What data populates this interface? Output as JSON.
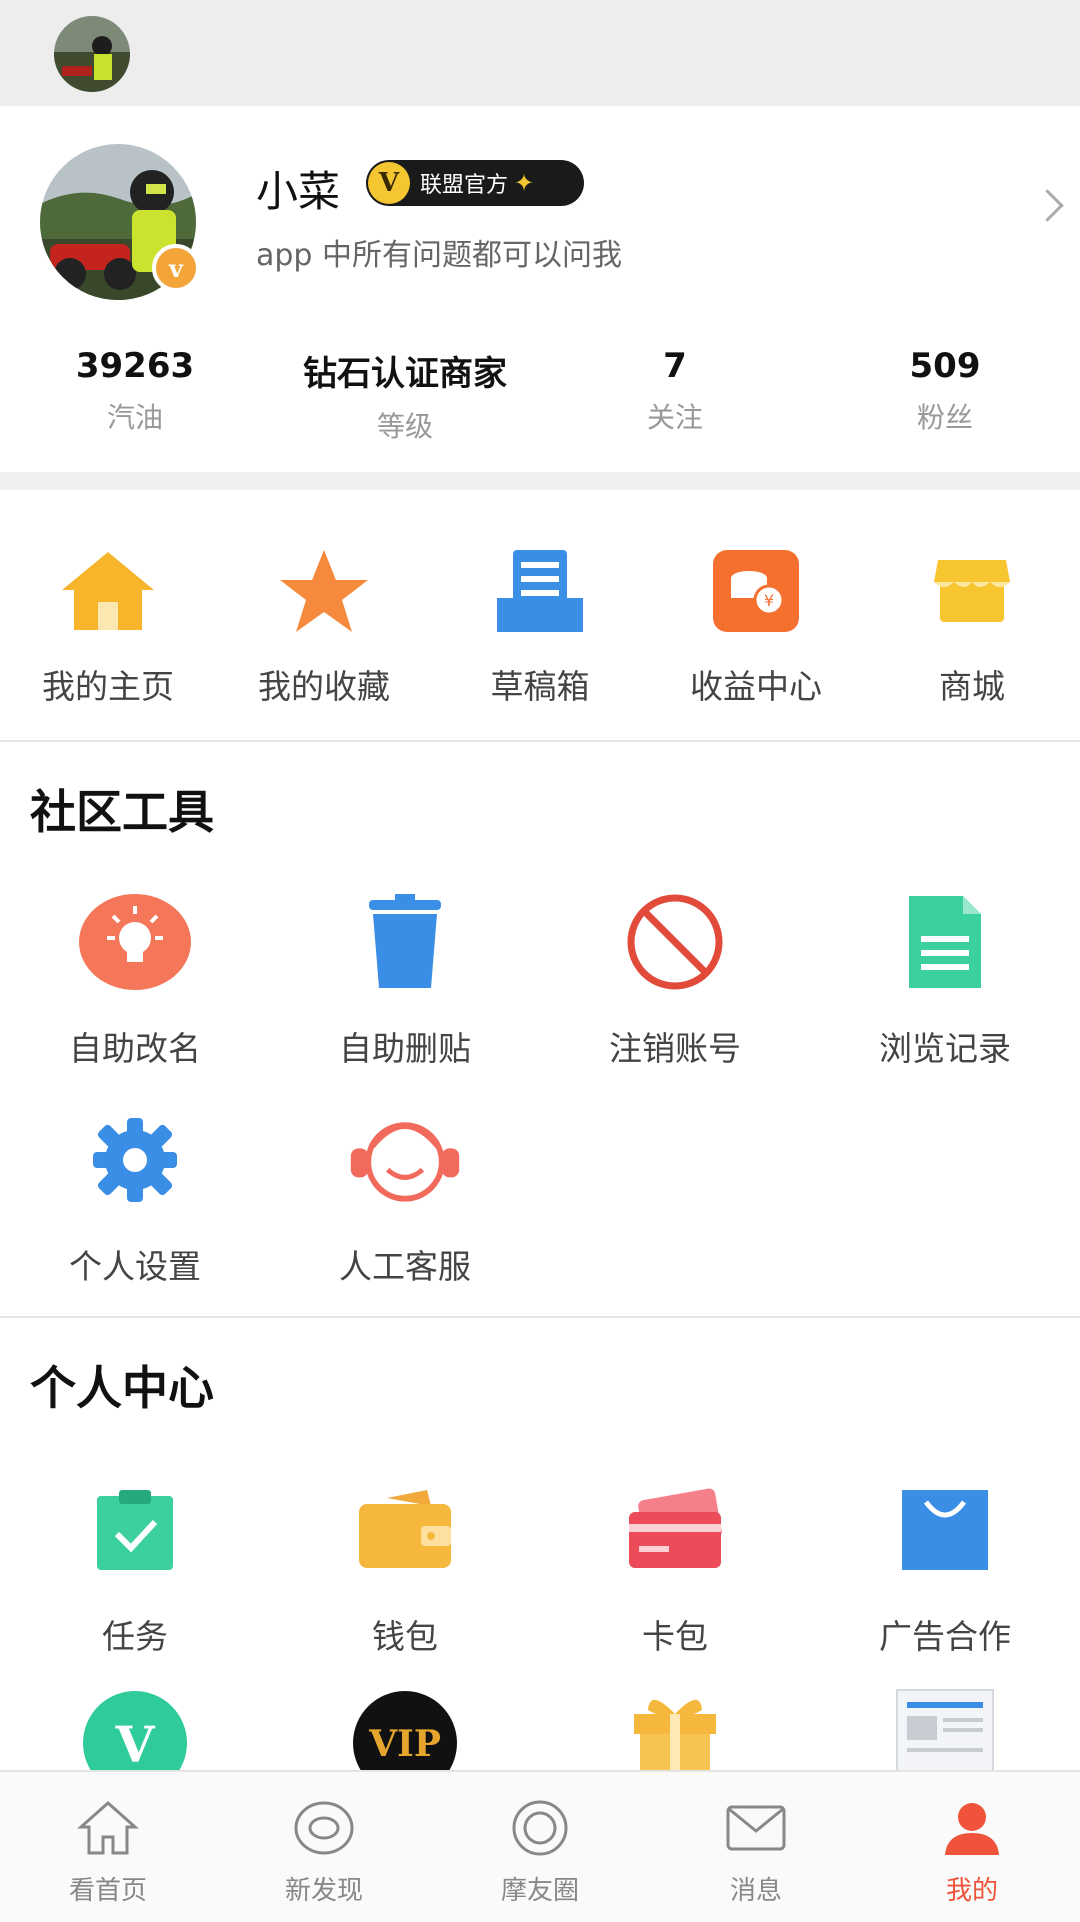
{
  "profile": {
    "name": "小菜",
    "badge_letter": "V",
    "badge_text": "联盟官方",
    "avatar_badge": "v",
    "bio": "app 中所有问题都可以问我",
    "stats": [
      {
        "value": "39263",
        "label": "汽油"
      },
      {
        "value": "钻石认证商家",
        "label": "等级"
      },
      {
        "value": "7",
        "label": "关注"
      },
      {
        "value": "509",
        "label": "粉丝"
      }
    ]
  },
  "quick_links": [
    {
      "label": "我的主页",
      "icon": "home-icon"
    },
    {
      "label": "我的收藏",
      "icon": "star-icon"
    },
    {
      "label": "草稿箱",
      "icon": "drafts-icon"
    },
    {
      "label": "收益中心",
      "icon": "earnings-icon"
    },
    {
      "label": "商城",
      "icon": "shop-icon"
    }
  ],
  "community_tools": {
    "title": "社区工具",
    "items": [
      {
        "label": "自助改名",
        "icon": "lightbulb-icon"
      },
      {
        "label": "自助删贴",
        "icon": "trash-icon"
      },
      {
        "label": "注销账号",
        "icon": "prohibit-icon"
      },
      {
        "label": "浏览记录",
        "icon": "document-icon"
      },
      {
        "label": "个人设置",
        "icon": "gear-icon"
      },
      {
        "label": "人工客服",
        "icon": "headset-icon"
      }
    ]
  },
  "personal_center": {
    "title": "个人中心",
    "items": [
      {
        "label": "任务",
        "icon": "clipboard-check-icon"
      },
      {
        "label": "钱包",
        "icon": "wallet-icon"
      },
      {
        "label": "卡包",
        "icon": "card-icon"
      },
      {
        "label": "广告合作",
        "icon": "shopping-bag-icon"
      },
      {
        "label": "",
        "icon": "v-badge-icon",
        "glyph": "V"
      },
      {
        "label": "",
        "icon": "vip-icon",
        "glyph": "VIP"
      },
      {
        "label": "",
        "icon": "gift-icon"
      },
      {
        "label": "",
        "icon": "newspaper-icon"
      }
    ]
  },
  "tabs": [
    {
      "label": "看首页",
      "icon": "home-outline-icon"
    },
    {
      "label": "新发现",
      "icon": "discover-icon"
    },
    {
      "label": "摩友圈",
      "icon": "circle-icon"
    },
    {
      "label": "消息",
      "icon": "mail-icon"
    },
    {
      "label": "我的",
      "icon": "user-icon",
      "active": true
    }
  ],
  "colors": {
    "accent": "#f0533b",
    "gold": "#f4c631",
    "blue": "#3a8ee6"
  }
}
